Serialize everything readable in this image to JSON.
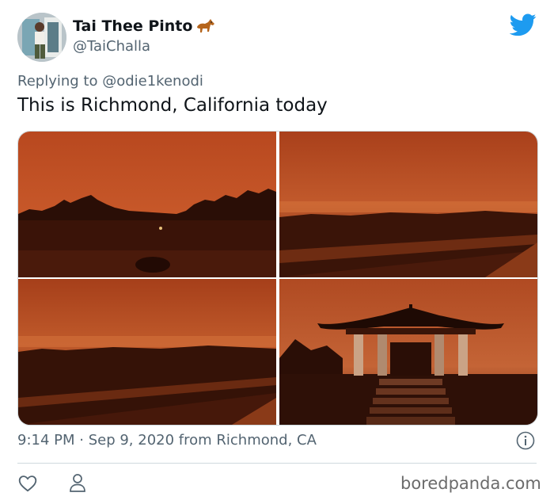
{
  "user": {
    "name": "Tai Thee Pinto",
    "handle": "@TaiChalla",
    "avatar_icon": "profile-photo",
    "name_emoji": "horse-emoji"
  },
  "brand_icon": "twitter-bird-icon",
  "reply": {
    "prefix": "Replying to",
    "mention": "@odie1kenodi"
  },
  "tweet_text": "This is Richmond, California today",
  "photos": [
    {
      "scene": "dark silhouette of trees under orange sky"
    },
    {
      "scene": "orange sky over field and road"
    },
    {
      "scene": "orange sky over field and road, wider view"
    },
    {
      "scene": "pagoda pavilion silhouette under orange sky"
    }
  ],
  "meta": {
    "text": "9:14 PM · Sep 9, 2020 from Richmond, CA"
  },
  "actions": {
    "like_icon": "heart-icon",
    "profile_icon": "person-icon",
    "info_icon": "info-icon"
  },
  "watermark": "boredpanda.com",
  "colors": {
    "twitter_blue": "#1d9bf0",
    "secondary_text": "#536471",
    "primary_text": "#0f1419",
    "sky_orange": "#c0522a"
  }
}
